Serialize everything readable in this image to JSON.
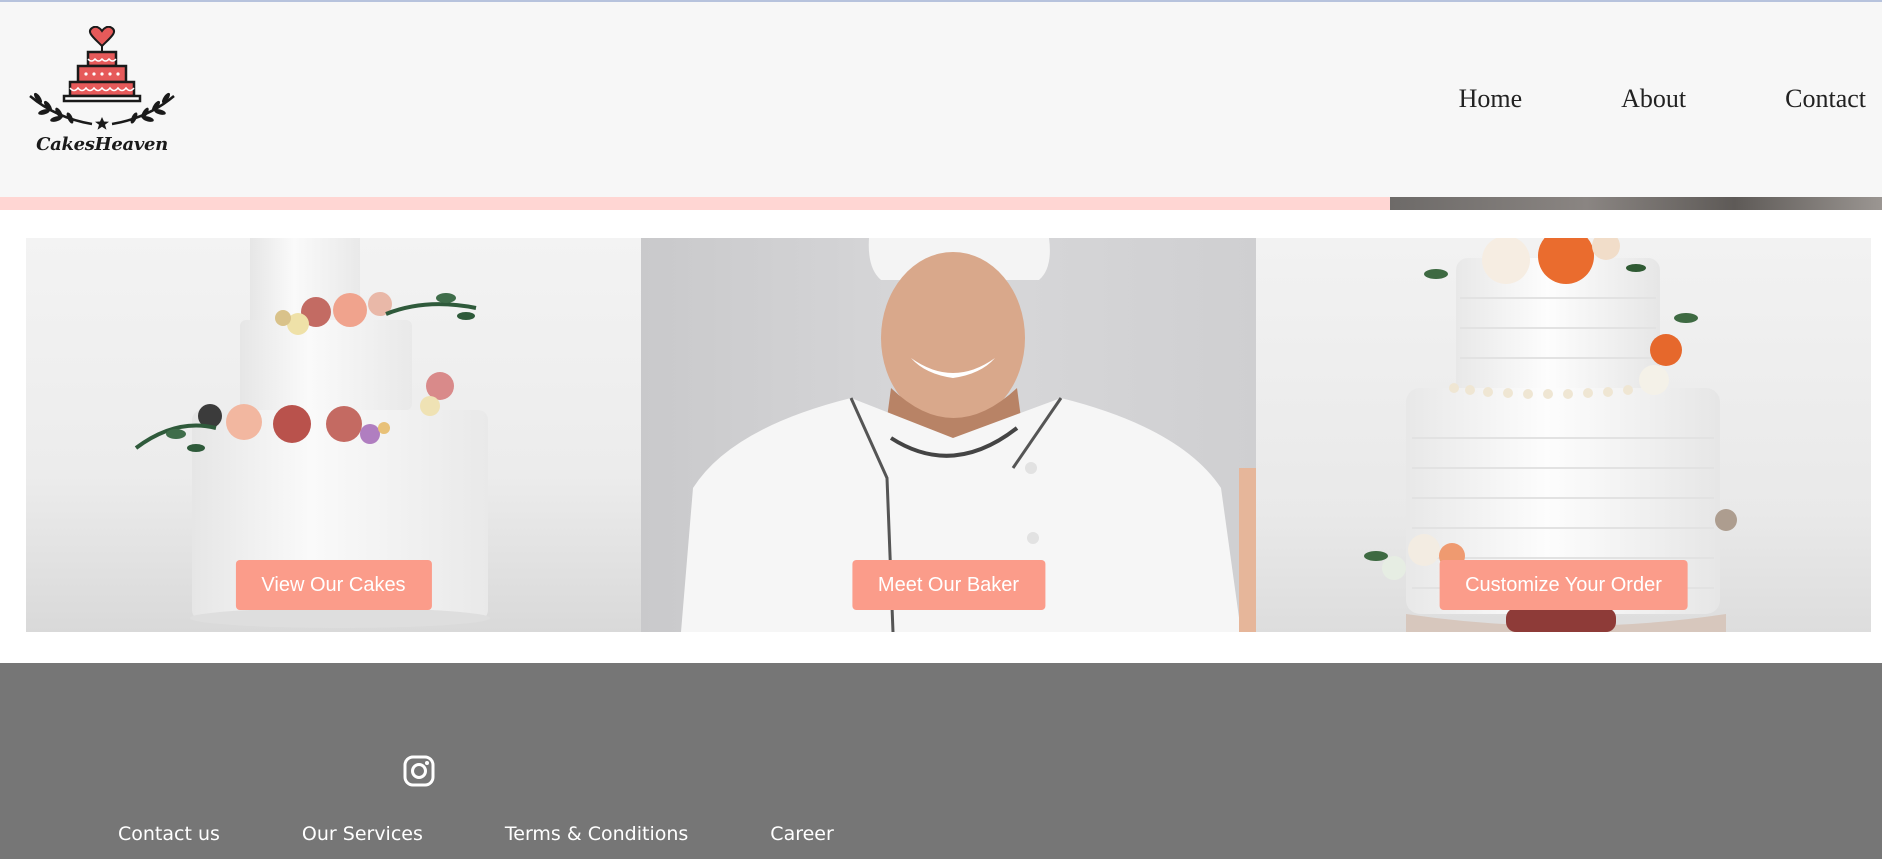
{
  "brand": {
    "name": "CakesHeaven"
  },
  "nav": {
    "items": [
      "Home",
      "About",
      "Contact"
    ]
  },
  "tiles": [
    {
      "button": "View Our Cakes"
    },
    {
      "button": "Meet Our Baker"
    },
    {
      "button": "Customize Your Order"
    }
  ],
  "footer": {
    "social_icon": "instagram-icon",
    "links": [
      "Contact us",
      "Our Services",
      "Terms & Conditions",
      "Career"
    ]
  },
  "colors": {
    "header_bg": "#f7f7f7",
    "accent_strip": "#ffd6d3",
    "button_bg": "#fb9c8a",
    "footer_bg": "#767676"
  }
}
